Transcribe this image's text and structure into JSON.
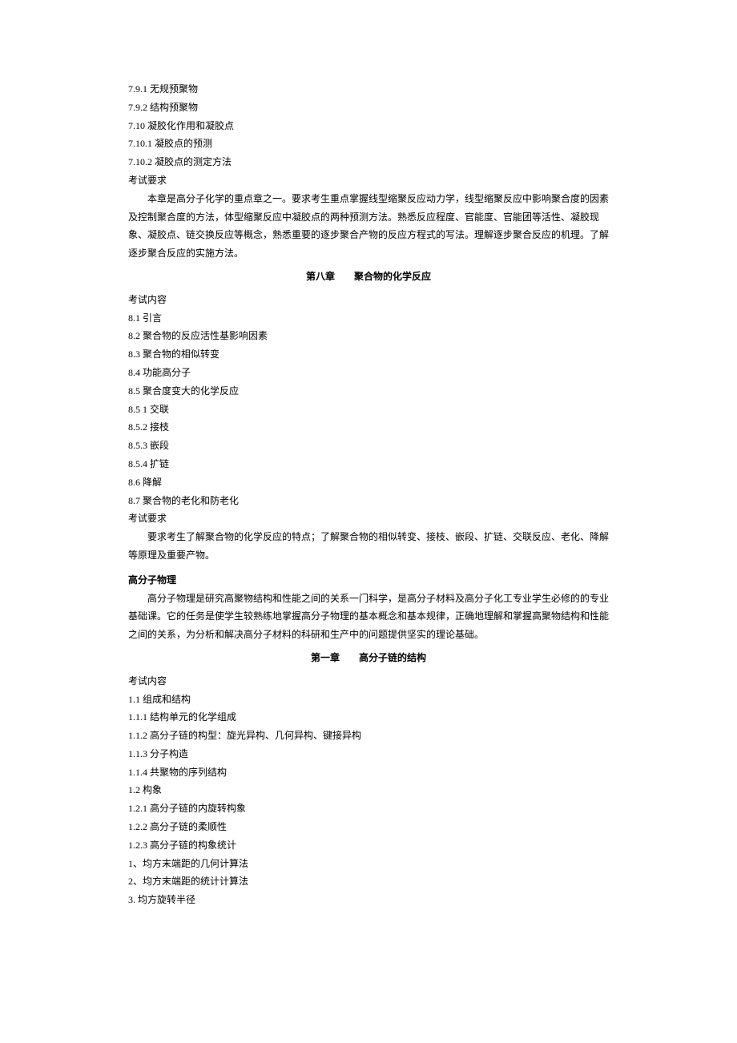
{
  "top_items": [
    "7.9.1 无规预聚物",
    "7.9.2 结构预聚物"
  ],
  "item_710": "7.10 凝胶化作用和凝胶点",
  "item_710_sub": [
    "7.10.1 凝胶点的预测",
    "7.10.2 凝胶点的测定方法"
  ],
  "exam_req_label": "考试要求",
  "exam_req_ch7": "本章是高分子化学的重点章之一。要求考生重点掌握线型缩聚反应动力学，线型缩聚反应中影响聚合度的因素及控制聚合度的方法，体型缩聚反应中凝胶点的两种预测方法。熟悉反应程度、官能度、官能团等活性、凝胶现象、凝胶点、链交换反应等概念，熟悉重要的逐步聚合产物的反应方程式的写法。理解逐步聚合反应的机理。了解逐步聚合反应的实施方法。",
  "ch8_title": "第八章  聚合物的化学反应",
  "exam_content_label": "考试内容",
  "ch8_items": [
    "8.1 引言",
    "8.2 聚合物的反应活性基影响因素",
    "8.3 聚合物的相似转变",
    "8.4 功能高分子",
    "8.5 聚合度变大的化学反应"
  ],
  "ch8_5_sub": [
    "8.5 1 交联",
    "8.5.2 接枝",
    "8.5.3 嵌段",
    "8.5.4 扩链"
  ],
  "ch8_items2": [
    "8.6 降解",
    "8.7 聚合物的老化和防老化"
  ],
  "exam_req_ch8": "要求考生了解聚合物的化学反应的特点；了解聚合物的相似转变、接枝、嵌段、扩链、交联反应、老化、降解等原理及重要产物。",
  "physics_title": "高分子物理",
  "physics_intro": "高分子物理是研究高聚物结构和性能之间的关系一门科学，是高分子材料及高分子化工专业学生必修的的专业基础课。它的任务是使学生较熟练地掌握高分子物理的基本概念和基本规律，正确地理解和掌握高聚物结构和性能之间的关系，为分析和解决高分子材料的科研和生产中的问题提供坚实的理论基础。",
  "ch1_title": "第一章  高分子链的结构",
  "ch1_items": {
    "i11": "1.1 组成和结构",
    "i111": "1.1.1 结构单元的化学组成",
    "i112": "1.1.2 高分子链的构型：旋光异构、几何异构、键接异构",
    "i113": "1.1.3 分子构造",
    "i114": "1.1.4 共聚物的序列结构",
    "i12": "1.2 构象",
    "i121": "1.2.1 高分子链的内旋转构象",
    "i122": "1.2.2 高分子链的柔顺性",
    "i123": "1.2.3 高分子链的构象统计",
    "sub1": "1、均方末端距的几何计算法",
    "sub2": "2、均方末端距的统计计算法",
    "sub3": "3. 均方旋转半径"
  }
}
